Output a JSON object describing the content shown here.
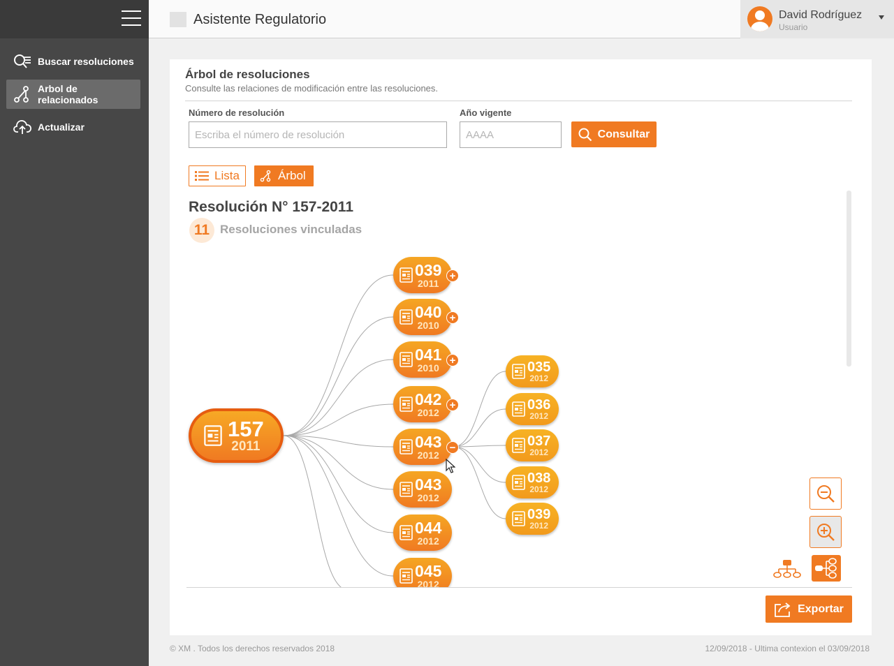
{
  "header": {
    "app_title": "Asistente Regulatorio",
    "user_name": "David Rodríguez",
    "user_role": "Usuario"
  },
  "sidebar": {
    "items": [
      {
        "label": "Buscar resoluciones",
        "icon": "search-list-icon"
      },
      {
        "label": "Arbol de relacionados",
        "icon": "tree-icon",
        "active": true
      },
      {
        "label": "Actualizar",
        "icon": "cloud-upload-icon"
      }
    ]
  },
  "card": {
    "title": "Árbol de resoluciones",
    "subtitle": "Consulte las relaciones de modificación entre las resoluciones."
  },
  "form": {
    "resolution_label": "Número de resolución",
    "resolution_placeholder": "Escriba el número de resolución",
    "year_label": "Año vigente",
    "year_placeholder": "AAAA",
    "consultar_label": "Consultar"
  },
  "views": {
    "lista_label": "Lista",
    "arbol_label": "Árbol"
  },
  "result": {
    "title": "Resolución N° 157-2011",
    "linked_count": "11",
    "linked_label": "Resoluciones vinculadas"
  },
  "tree": {
    "root": {
      "number": "157",
      "year": "2011"
    },
    "level1": [
      {
        "number": "039",
        "year": "2011",
        "toggle": "+"
      },
      {
        "number": "040",
        "year": "2010",
        "toggle": "+"
      },
      {
        "number": "041",
        "year": "2010",
        "toggle": "+"
      },
      {
        "number": "042",
        "year": "2012",
        "toggle": "+"
      },
      {
        "number": "043",
        "year": "2012",
        "toggle": "−"
      },
      {
        "number": "043",
        "year": "2012"
      },
      {
        "number": "044",
        "year": "2012"
      },
      {
        "number": "045",
        "year": "2012"
      }
    ],
    "level2": [
      {
        "number": "035",
        "year": "2012"
      },
      {
        "number": "036",
        "year": "2012"
      },
      {
        "number": "037",
        "year": "2012"
      },
      {
        "number": "038",
        "year": "2012"
      },
      {
        "number": "039",
        "year": "2012"
      }
    ]
  },
  "actions": {
    "export_label": "Exportar"
  },
  "footer": {
    "copyright": "© XM . Todos los derechos reservados 2018",
    "last_connection": "12/09/2018 - Ultima contexion el 03/09/2018"
  },
  "colors": {
    "accent": "#f07a22",
    "sidebar_bg": "#474747",
    "sidebar_active": "#6b6b6b"
  }
}
